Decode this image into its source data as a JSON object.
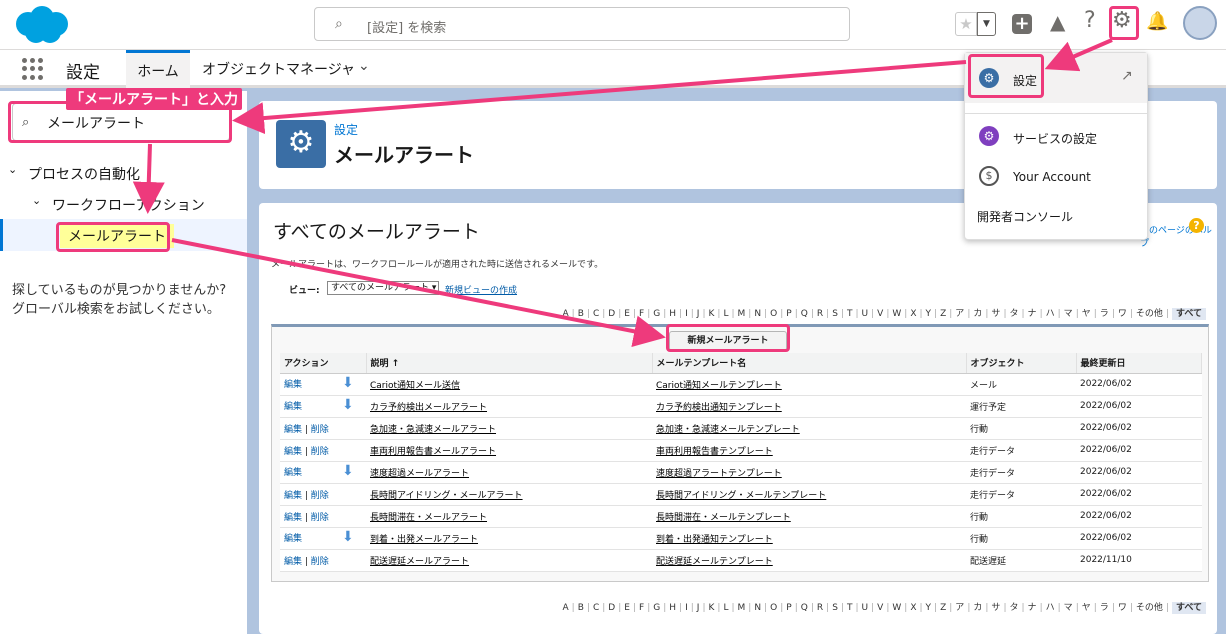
{
  "header": {
    "search_placeholder": "[設定] を検索"
  },
  "nav": {
    "app_title": "設定",
    "tab_home": "ホーム",
    "tab_object_manager": "オブジェクトマネージャ"
  },
  "sidebar": {
    "quickfind_value": "メールアラート",
    "tree": [
      {
        "label": "プロセスの自動化"
      },
      {
        "label": "ワークフローアクション"
      },
      {
        "label": "メールアラート"
      }
    ],
    "help_text_1": "探しているものが見つかりませんか?",
    "help_text_2": "グローバル検索をお試しください。"
  },
  "page_header": {
    "subtitle": "設定",
    "title": "メールアラート"
  },
  "main": {
    "title": "すべてのメールアラート",
    "help_link": "このページのヘルプ",
    "description": "メールアラートは、ワークフロールールが適用された時に送信されるメールです。",
    "view_label": "ビュー:",
    "view_selected": "すべてのメールアラート",
    "create_view_link": "新規ビューの作成",
    "alphabet": [
      "A",
      "B",
      "C",
      "D",
      "E",
      "F",
      "G",
      "H",
      "I",
      "J",
      "K",
      "L",
      "M",
      "N",
      "O",
      "P",
      "Q",
      "R",
      "S",
      "T",
      "U",
      "V",
      "W",
      "X",
      "Y",
      "Z",
      "ア",
      "カ",
      "サ",
      "タ",
      "ナ",
      "ハ",
      "マ",
      "ヤ",
      "ラ",
      "ワ",
      "その他",
      "すべて"
    ],
    "new_button": "新規メールアラート",
    "columns": [
      "アクション",
      "説明 ↑",
      "メールテンプレート名",
      "オブジェクト",
      "最終更新日"
    ],
    "edit_label": "編集",
    "delete_label": "削除",
    "rows": [
      {
        "desc": "Cariot通知メール送信",
        "template": "Cariot通知メールテンプレート",
        "object": "メール",
        "date": "2022/06/02",
        "deletable": false
      },
      {
        "desc": "カラ予約検出メールアラート",
        "template": "カラ予約検出通知テンプレート",
        "object": "運行予定",
        "date": "2022/06/02",
        "deletable": false
      },
      {
        "desc": "急加速・急減速メールアラート",
        "template": "急加速・急減速メールテンプレート",
        "object": "行動",
        "date": "2022/06/02",
        "deletable": true
      },
      {
        "desc": "車両利用報告書メールアラート",
        "template": "車両利用報告書テンプレート",
        "object": "走行データ",
        "date": "2022/06/02",
        "deletable": true
      },
      {
        "desc": "速度超過メールアラート",
        "template": "速度超過アラートテンプレート",
        "object": "走行データ",
        "date": "2022/06/02",
        "deletable": false
      },
      {
        "desc": "長時間アイドリング・メールアラート",
        "template": "長時間アイドリング・メールテンプレート",
        "object": "走行データ",
        "date": "2022/06/02",
        "deletable": true
      },
      {
        "desc": "長時間滞在・メールアラート",
        "template": "長時間滞在・メールテンプレート",
        "object": "行動",
        "date": "2022/06/02",
        "deletable": true
      },
      {
        "desc": "到着・出発メールアラート",
        "template": "到着・出発通知テンプレート",
        "object": "行動",
        "date": "2022/06/02",
        "deletable": false
      },
      {
        "desc": "配送遅延メールアラート",
        "template": "配送遅延メールテンプレート",
        "object": "配送遅延",
        "date": "2022/11/10",
        "deletable": true
      }
    ]
  },
  "dropdown": {
    "setup": "設定",
    "service_setup": "サービスの設定",
    "your_account": "Your Account",
    "dev_console": "開発者コンソール"
  },
  "annotation": {
    "label": "「メールアラート」と入力"
  },
  "colors": {
    "brand": "#00a1e0",
    "highlight": "#ee3a7c",
    "header_icon": "#3a6ea5",
    "link": "#015ba7"
  }
}
